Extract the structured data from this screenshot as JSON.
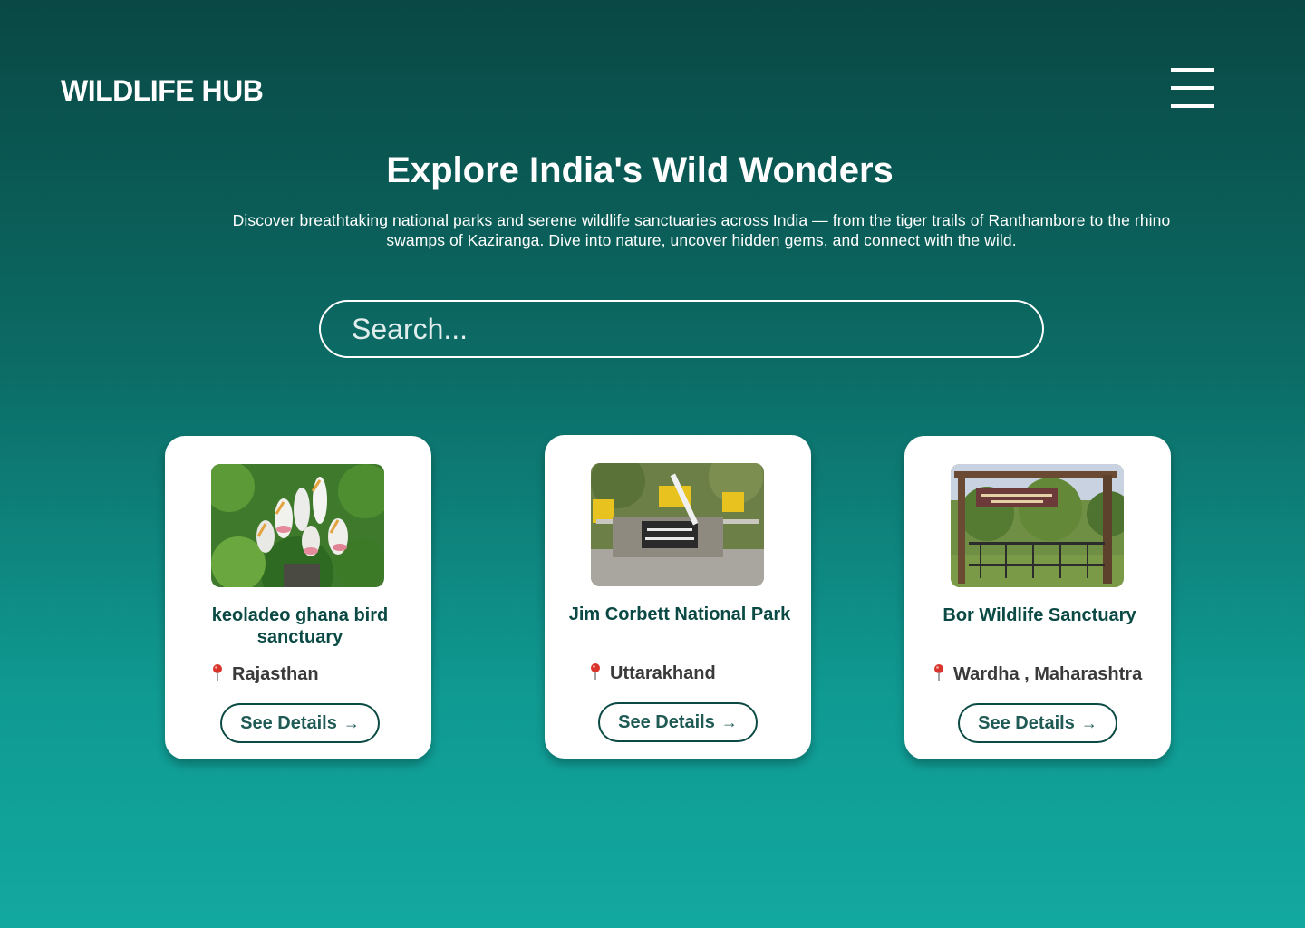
{
  "header": {
    "brand": "WILDLIFE HUB",
    "menu_icon": "hamburger-menu-icon"
  },
  "hero": {
    "title": "Explore India's Wild Wonders",
    "subtitle": "Discover breathtaking national parks and serene wildlife sanctuaries across India — from the tiger trails of Ranthambore to the rhino swamps of Kaziranga. Dive into nature, uncover hidden gems, and connect with the wild."
  },
  "search": {
    "placeholder": "Search...",
    "value": ""
  },
  "cards": [
    {
      "title": "keoladeo ghana bird sanctuary",
      "location": "Rajasthan",
      "button_label": "See Details",
      "image_subject": "painted storks in trees"
    },
    {
      "title": "Jim Corbett National Park",
      "location": "Uttarakhand",
      "button_label": "See Details",
      "image_subject": "Corbett tiger reserve entrance gate"
    },
    {
      "title": "Bor Wildlife Sanctuary",
      "location": "Wardha , Maharashtra",
      "button_label": "See Details",
      "image_subject": "wooden sanctuary entrance arch with fence"
    }
  ],
  "icons": {
    "location": "map-pin-icon",
    "arrow": "arrow-right-icon"
  },
  "colors": {
    "background_top": "#094844",
    "background_bottom": "#12a8a0",
    "card_text": "#0b4a44",
    "location_pin": "#d9342b"
  }
}
